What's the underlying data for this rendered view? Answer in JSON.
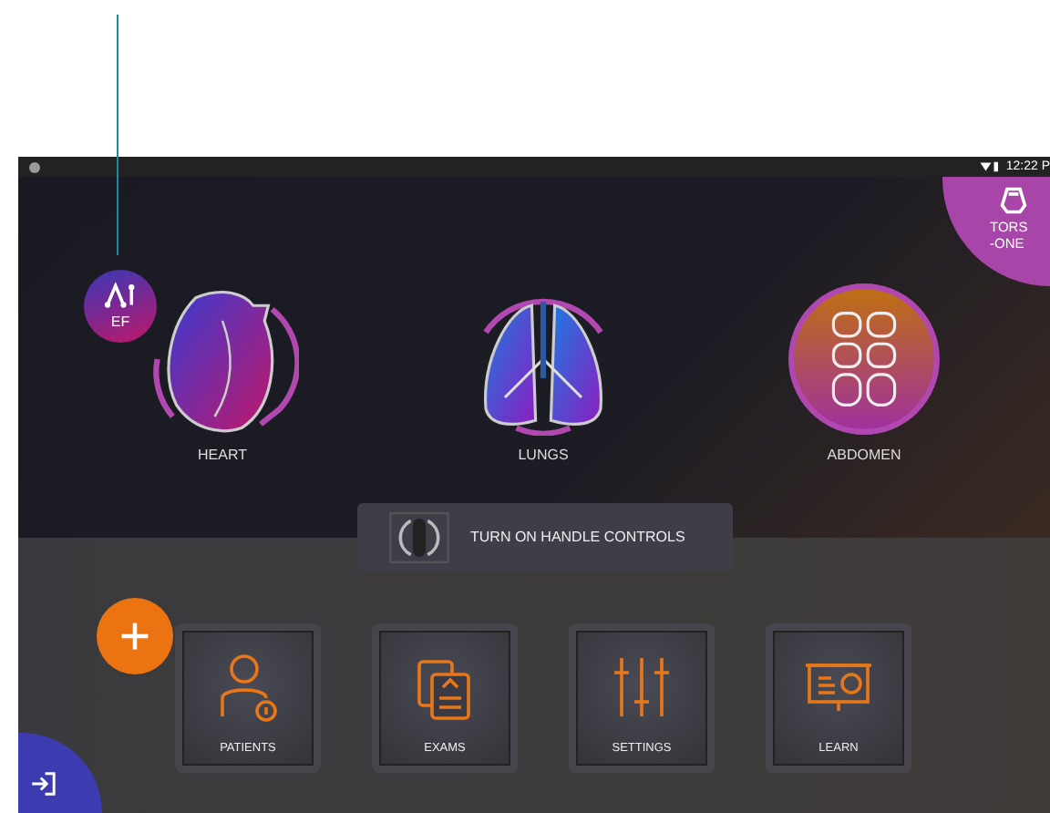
{
  "status_bar": {
    "time": "12:22 P"
  },
  "probe_badge": {
    "label_lines": [
      "TORS",
      "-ONE"
    ]
  },
  "ef_badge": {
    "label": "EF"
  },
  "organs": [
    {
      "label": "HEART",
      "kind": "heart"
    },
    {
      "label": "LUNGS",
      "kind": "lungs"
    },
    {
      "label": "ABDOMEN",
      "kind": "abdomen"
    }
  ],
  "handle_controls": {
    "label": "TURN ON HANDLE CONTROLS"
  },
  "tiles": [
    {
      "label": "PATIENTS",
      "kind": "patients"
    },
    {
      "label": "EXAMS",
      "kind": "exams"
    },
    {
      "label": "SETTINGS",
      "kind": "settings"
    },
    {
      "label": "LEARN",
      "kind": "learn"
    }
  ]
}
